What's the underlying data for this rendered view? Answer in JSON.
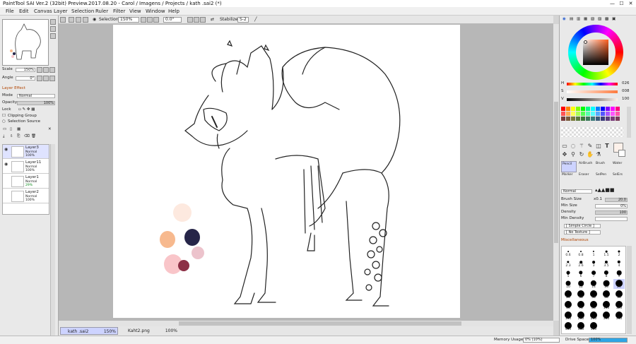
{
  "window": {
    "title": "PaintTool SAI Ver.2 (32bit) Preview.2017.08.20 - Carol / Imagens / Projects / kath .sai2 (*)"
  },
  "menu": [
    "File",
    "Edit",
    "Canvas",
    "Layer",
    "Selection",
    "Ruler",
    "Filter",
    "View",
    "Window",
    "Help"
  ],
  "toolbar": {
    "selection_label": "Selection",
    "zoom": "150%",
    "angle": "0.0°",
    "stabilizer_label": "Stabilizer",
    "stabilizer_value": "S-2"
  },
  "navigator": {
    "scale_label": "Scale",
    "scale_value": "150%",
    "angle_label": "Angle",
    "angle_value": "0°"
  },
  "layer_panel": {
    "effect_label": "Layer Effect",
    "mode_label": "Mode",
    "mode_value": "Normal",
    "opacity_label": "Opacity",
    "opacity_value": "100%",
    "lock_label": "Lock",
    "clipping_label": "Clipping Group",
    "selection_source_label": "Selection Source",
    "layers": [
      {
        "name": "Layer3",
        "mode": "Normal",
        "opacity": "100%"
      },
      {
        "name": "Layer11",
        "mode": "Normal",
        "opacity": "100%"
      },
      {
        "name": "Layer1",
        "mode": "Normal",
        "opacity": "29%"
      },
      {
        "name": "Layer2",
        "mode": "Normal",
        "opacity": "100%"
      }
    ]
  },
  "documents": [
    {
      "name": "kath .sai2",
      "zoom": "150%"
    },
    {
      "name": "Kaht2.png",
      "zoom": "100%"
    }
  ],
  "status": {
    "memory_label": "Memory Usage",
    "memory_value": "0% (10%)",
    "drive_label": "Drive Space",
    "drive_value": "100%"
  },
  "color": {
    "h_label": "H",
    "h_value": "026",
    "s_label": "S",
    "s_value": "008",
    "v_label": "V",
    "v_value": "100",
    "current": "#fdf1ea"
  },
  "palette_swatches": [
    "#ff0000",
    "#ff8000",
    "#ffff00",
    "#80ff00",
    "#00ff00",
    "#00ff80",
    "#00ffff",
    "#0080ff",
    "#0000ff",
    "#8000ff",
    "#ff00ff",
    "#ff0080",
    "#ff5555",
    "#ffaa55",
    "#ffff55",
    "#aaff55",
    "#55ff55",
    "#55ffaa",
    "#55ffff",
    "#55aaff",
    "#5555ff",
    "#aa55ff",
    "#ff55ff",
    "#ff55aa",
    "#7a3b3b",
    "#7a5a3b",
    "#7a7a3b",
    "#5a7a3b",
    "#3b7a3b",
    "#3b7a5a",
    "#3b7a7a",
    "#3b5a7a",
    "#3b3b7a",
    "#5a3b7a",
    "#7a3b7a",
    "#7a3b5a"
  ],
  "tools": {
    "brushes": [
      "Pencil",
      "AirBrush",
      "Brush",
      "Water"
    ],
    "brushes2": [
      "Marker",
      "Eraser",
      "SelPen",
      "SelErs"
    ],
    "mode_value": "Normal",
    "brush_size_label": "Brush Size",
    "brush_size_mult": "x0.1",
    "brush_size_value": "20.0",
    "min_size_label": "Min Size",
    "min_size_value": "0%",
    "density_label": "Density",
    "density_value": "100",
    "min_density_label": "Min Density",
    "shape_value": "[ Simple Circle ]",
    "texture_value": "[ No Texture ]",
    "misc_label": "Miscellaneous"
  },
  "brush_sizes": [
    "0.6",
    "0.8",
    "1",
    "1.5",
    "2",
    "2.3",
    "2.6",
    "3",
    "3.5",
    "4",
    "5",
    "6",
    "7",
    "8",
    "9",
    "10",
    "12",
    "14",
    "16",
    "20",
    "25",
    "30",
    "35",
    "40",
    "50",
    "60",
    "70",
    "80",
    "100",
    "120",
    "160",
    "200",
    "250",
    "300",
    "350",
    "400",
    "450",
    "500"
  ],
  "canvas_swatches": [
    "#fde9df",
    "#f7b98e",
    "#262548",
    "#ecc3cc",
    "#f9c5c9",
    "#8c2f45"
  ]
}
